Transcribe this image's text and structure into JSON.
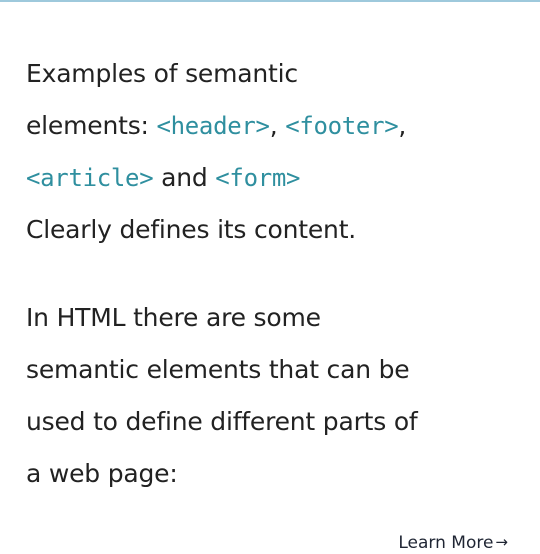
{
  "paragraph1": {
    "line1": "Examples of semantic",
    "line2_prefix": "elements: ",
    "tag_header": "<header>",
    "sep1": ", ",
    "tag_footer": "<footer>",
    "sep2": ",",
    "tag_article": "<article>",
    "and_text": " and ",
    "tag_form": "<form>",
    "line4": "Clearly defines its content."
  },
  "paragraph2": {
    "line1": "In HTML there are some",
    "line2": "semantic elements that can be",
    "line3": "used to define different parts of",
    "line4": "a web page:"
  },
  "learn_more": {
    "label": "Learn More",
    "arrow": "→"
  },
  "colors": {
    "code_accent": "#2f8f9f",
    "body_text": "#222222",
    "top_rule": "#9ec9dc"
  }
}
